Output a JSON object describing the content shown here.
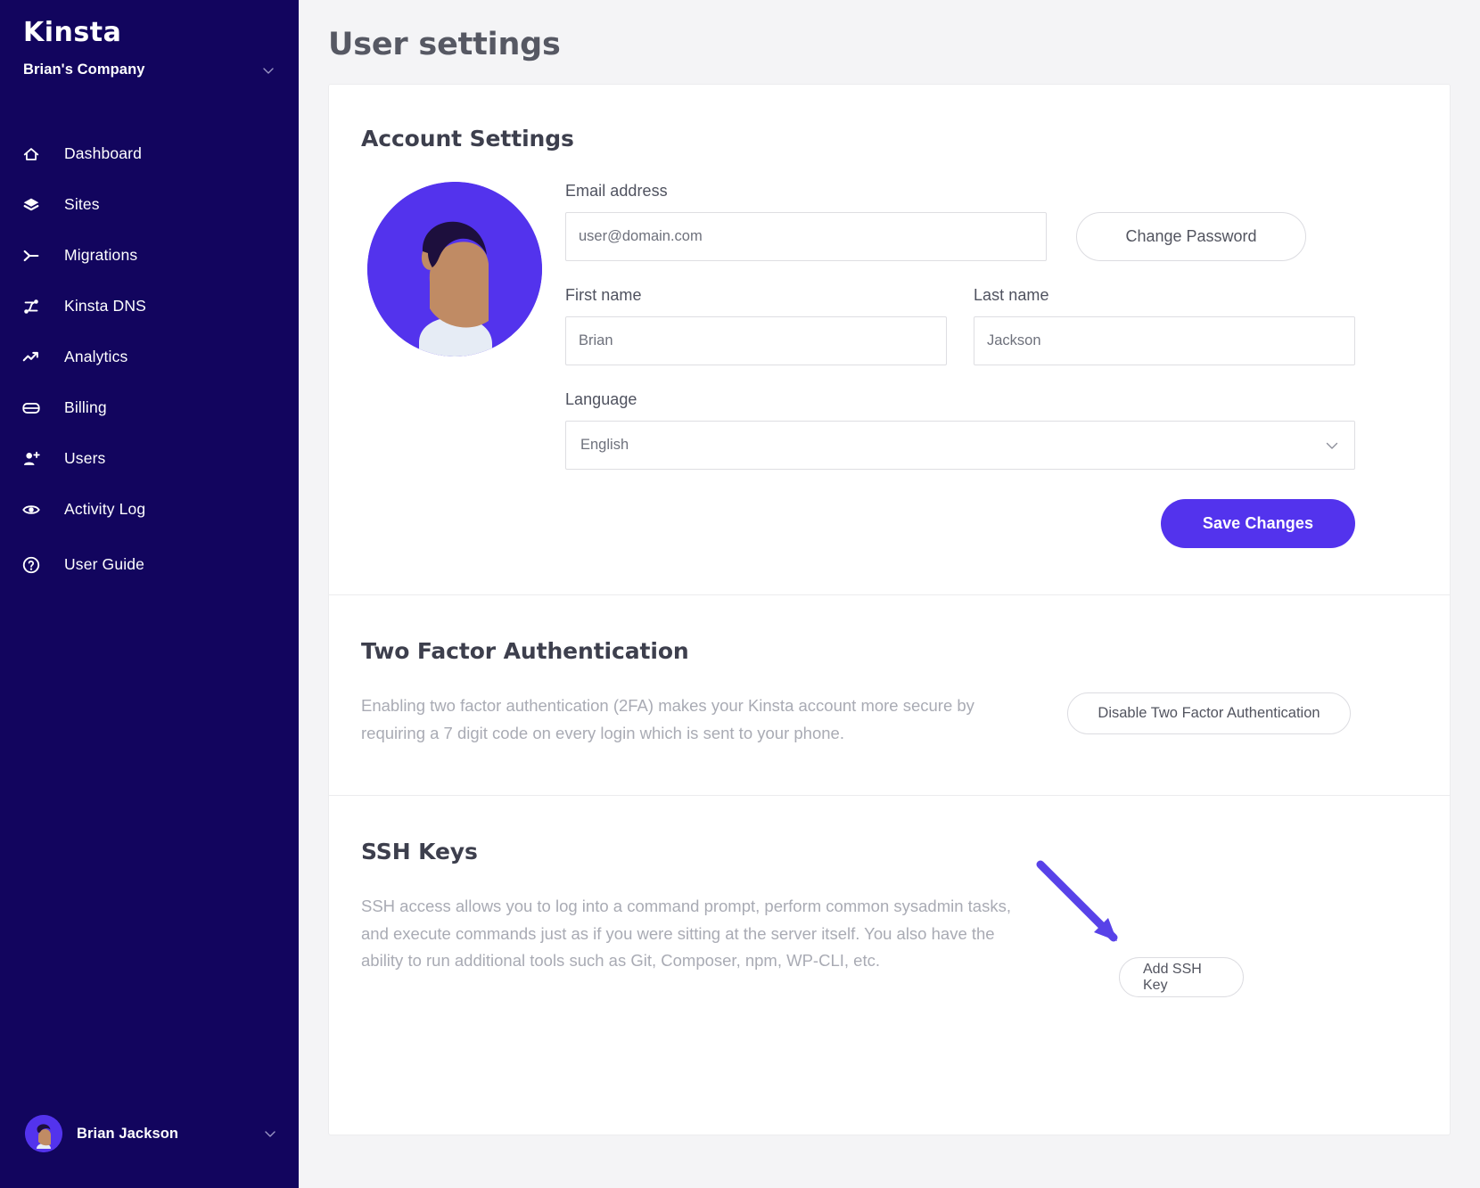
{
  "sidebar": {
    "logo_text": "Kinsta",
    "company_name": "Brian's Company",
    "company_chevron_icon": "chevron-down-icon",
    "nav_items": [
      {
        "label": "Dashboard",
        "icon": "home-icon"
      },
      {
        "label": "Sites",
        "icon": "layers-icon"
      },
      {
        "label": "Migrations",
        "icon": "migrations-arrow-icon"
      },
      {
        "label": "Kinsta DNS",
        "icon": "dns-branch-icon"
      },
      {
        "label": "Analytics",
        "icon": "trending-up-icon"
      },
      {
        "label": "Billing",
        "icon": "credit-card-icon"
      },
      {
        "label": "Users",
        "icon": "user-plus-icon"
      },
      {
        "label": "Activity Log",
        "icon": "eye-icon"
      },
      {
        "label": "User Guide",
        "icon": "question-circle-icon"
      }
    ],
    "user": {
      "name": "Brian Jackson",
      "avatar_icon": "user-avatar",
      "chevron_icon": "chevron-down-icon"
    }
  },
  "header": {
    "title": "User settings"
  },
  "account": {
    "section_title": "Account Settings",
    "avatar_icon": "user-avatar-large",
    "email": {
      "label": "Email address",
      "value": "user@domain.com",
      "placeholder": "user@domain.com"
    },
    "change_password_label": "Change Password",
    "first_name": {
      "label": "First name",
      "value": "Brian",
      "placeholder": "First name"
    },
    "last_name": {
      "label": "Last name",
      "value": "Jackson",
      "placeholder": "Last name"
    },
    "language": {
      "label": "Language",
      "value": "English",
      "caret_icon": "chevron-down-icon",
      "options": [
        "English"
      ]
    },
    "save_label": "Save Changes"
  },
  "two_factor": {
    "section_title": "Two Factor Authentication",
    "description": "Enabling two factor authentication (2FA) makes your Kinsta account more secure by requiring a 7 digit code on every login which is sent to your phone.",
    "button_label": "Disable Two Factor Authentication"
  },
  "ssh": {
    "section_title": "SSH Keys",
    "description": "SSH access allows you to log into a command prompt, perform common sysadmin tasks, and execute commands just as if you were sitting at the server itself. You also have the ability to run additional tools such as Git, Composer, npm, WP-CLI, etc.",
    "button_label": "Add SSH Key",
    "annotation_icon": "arrow-annotation-icon"
  },
  "colors": {
    "sidebar_bg": "#12055e",
    "accent_purple": "#5333ed",
    "page_bg": "#f4f4f6",
    "card_bg": "#ffffff",
    "muted_text": "#a9abb4",
    "title_text": "#565863"
  }
}
